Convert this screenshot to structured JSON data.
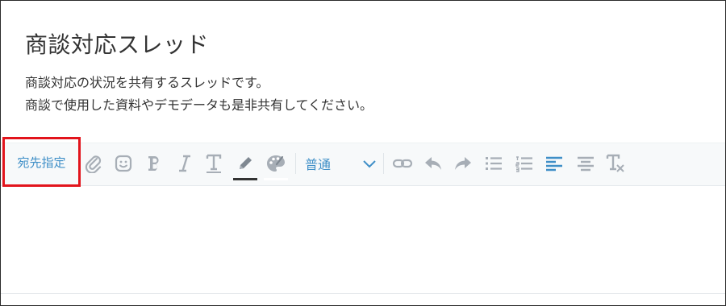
{
  "thread": {
    "title": "商談対応スレッド",
    "description_lines": [
      "商談対応の状況を共有するスレッドです。",
      "商談で使用した資料やデモデータも是非共有してください。"
    ]
  },
  "toolbar": {
    "mention_label": "宛先指定",
    "font_size_value": "普通",
    "icons": [
      "attachment-icon",
      "emoji-icon",
      "bold-icon",
      "italic-icon",
      "text-size-icon",
      "text-color-icon",
      "background-color-icon",
      "font-size-select",
      "link-icon",
      "undo-icon",
      "redo-icon",
      "bullet-list-icon",
      "numbered-list-icon",
      "align-left-icon",
      "align-center-icon",
      "clear-format-icon"
    ]
  },
  "colors": {
    "accent": "#3f8fc7",
    "icon": "#a7aeb6",
    "highlight_border": "#e2141c",
    "text_color_underline": "#333333",
    "background_color_underline": "#ffffff"
  }
}
